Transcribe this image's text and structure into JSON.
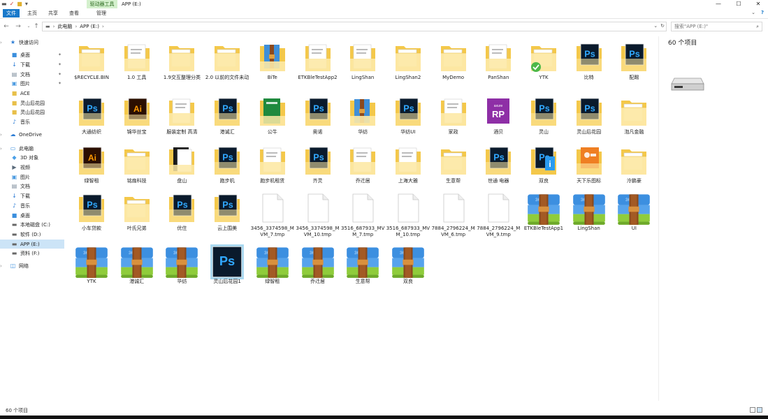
{
  "window": {
    "title": "APP (E:)",
    "context_tab": "驱动器工具",
    "minimize": "—",
    "maximize": "☐",
    "close": "✕"
  },
  "ribbon": {
    "tabs": [
      "文件",
      "主页",
      "共享",
      "查看",
      "管理"
    ],
    "expand": "⌄",
    "help": "?"
  },
  "address": {
    "crumbs": [
      "此电脑",
      "APP (E:)"
    ],
    "search_placeholder": "搜索\"APP (E:)\""
  },
  "nav": [
    {
      "label": "快速访问",
      "icon": "star-icon",
      "sel": false,
      "pin": false
    },
    {
      "label": "桌面",
      "icon": "desktop-icon",
      "sel": false,
      "pin": true
    },
    {
      "label": "下载",
      "icon": "download-icon",
      "sel": false,
      "pin": true
    },
    {
      "label": "文档",
      "icon": "document-icon",
      "sel": false,
      "pin": true
    },
    {
      "label": "图片",
      "icon": "picture-icon",
      "sel": false,
      "pin": true
    },
    {
      "label": "ACE",
      "icon": "folder-icon",
      "sel": false,
      "pin": false
    },
    {
      "label": "灵山后花园",
      "icon": "folder-icon",
      "sel": false,
      "pin": false
    },
    {
      "label": "灵山后花园",
      "icon": "folder-icon",
      "sel": false,
      "pin": false
    },
    {
      "label": "音乐",
      "icon": "music-icon",
      "sel": false,
      "pin": false
    },
    {
      "label": "OneDrive",
      "icon": "cloud-icon",
      "sel": false,
      "pin": false
    },
    {
      "label": "此电脑",
      "icon": "computer-icon",
      "sel": false,
      "pin": false
    },
    {
      "label": "3D 对象",
      "icon": "cube-icon",
      "sel": false,
      "pin": false
    },
    {
      "label": "视频",
      "icon": "video-icon",
      "sel": false,
      "pin": false
    },
    {
      "label": "图片",
      "icon": "picture-icon",
      "sel": false,
      "pin": false
    },
    {
      "label": "文档",
      "icon": "document-icon",
      "sel": false,
      "pin": false
    },
    {
      "label": "下载",
      "icon": "download-icon",
      "sel": false,
      "pin": false
    },
    {
      "label": "音乐",
      "icon": "music-icon",
      "sel": false,
      "pin": false
    },
    {
      "label": "桌面",
      "icon": "desktop-icon",
      "sel": false,
      "pin": false
    },
    {
      "label": "本地磁盘 (C:)",
      "icon": "drive-icon",
      "sel": false,
      "pin": false
    },
    {
      "label": "软件 (D:)",
      "icon": "drive-icon",
      "sel": false,
      "pin": false
    },
    {
      "label": "APP (E:)",
      "icon": "drive-icon",
      "sel": true,
      "pin": false
    },
    {
      "label": "资料 (F:)",
      "icon": "drive-icon",
      "sel": false,
      "pin": false
    },
    {
      "label": "网络",
      "icon": "network-icon",
      "sel": false,
      "pin": false
    }
  ],
  "files": [
    {
      "name": "$RECYCLE.BIN",
      "type": "folder"
    },
    {
      "name": "1.0 工具",
      "type": "folder-doc"
    },
    {
      "name": "1.9交互整理分类",
      "type": "folder"
    },
    {
      "name": "2.0 以前的文件未动",
      "type": "folder"
    },
    {
      "name": "BiTe",
      "type": "folder-zip"
    },
    {
      "name": "ETKBleTestApp2",
      "type": "folder-doc"
    },
    {
      "name": "LingShan",
      "type": "folder-doc"
    },
    {
      "name": "LingShan2",
      "type": "folder"
    },
    {
      "name": "MyDemo",
      "type": "folder"
    },
    {
      "name": "PanShan",
      "type": "folder-doc"
    },
    {
      "name": "YTK",
      "type": "folder-check"
    },
    {
      "name": "比特",
      "type": "folder-ps"
    },
    {
      "name": "配踢",
      "type": "folder-ps"
    },
    {
      "name": "大通纺织",
      "type": "folder-ps"
    },
    {
      "name": "锦华丝宝",
      "type": "folder-ai"
    },
    {
      "name": "服装定制 高清",
      "type": "folder-doc"
    },
    {
      "name": "港诚汇",
      "type": "folder-ps"
    },
    {
      "name": "公牛",
      "type": "folder-green"
    },
    {
      "name": "奥诺",
      "type": "folder-ps"
    },
    {
      "name": "华纺",
      "type": "folder-zip"
    },
    {
      "name": "华纺UI",
      "type": "folder-ps"
    },
    {
      "name": "家政",
      "type": "folder-doc"
    },
    {
      "name": "酒贝",
      "type": "folder-rp"
    },
    {
      "name": "灵山",
      "type": "folder-ps"
    },
    {
      "name": "灵山后花园",
      "type": "folder-ps"
    },
    {
      "name": "泡凡金融",
      "type": "folder"
    },
    {
      "name": "绿智租",
      "type": "folder-ai"
    },
    {
      "name": "铭扇科技",
      "type": "folder"
    },
    {
      "name": "盘山",
      "type": "folder-dark"
    },
    {
      "name": "跑步机",
      "type": "folder-ps"
    },
    {
      "name": "跑步机租赁",
      "type": "folder-doc"
    },
    {
      "name": "齐灵",
      "type": "folder-ps"
    },
    {
      "name": "乔迁居",
      "type": "folder-doc"
    },
    {
      "name": "上海大雅",
      "type": "folder-doc"
    },
    {
      "name": "生意帮",
      "type": "folder"
    },
    {
      "name": "世通 电器",
      "type": "folder-ps"
    },
    {
      "name": "双良",
      "type": "folder-blue"
    },
    {
      "name": "天下乐图标",
      "type": "folder-orange"
    },
    {
      "name": "泠鹏豪",
      "type": "folder"
    },
    {
      "name": "小车贷款",
      "type": "folder-ps"
    },
    {
      "name": "叶氏兄弟",
      "type": "folder"
    },
    {
      "name": "优住",
      "type": "folder-ps"
    },
    {
      "name": "云上围美",
      "type": "folder-ps"
    },
    {
      "name": "3456_3374598_MVM_7.tmp",
      "type": "file"
    },
    {
      "name": "3456_3374598_MVM_10.tmp",
      "type": "file"
    },
    {
      "name": "3516_687933_MVM_7.tmp",
      "type": "file"
    },
    {
      "name": "3516_687933_MVM_10.tmp",
      "type": "file"
    },
    {
      "name": "7884_2796224_MVM_6.tmp",
      "type": "file"
    },
    {
      "name": "7884_2796224_MVM_9.tmp",
      "type": "file"
    },
    {
      "name": "ETKBleTestApp1",
      "type": "archive"
    },
    {
      "name": "LingShan",
      "type": "archive"
    },
    {
      "name": "UI",
      "type": "archive"
    },
    {
      "name": "YTK",
      "type": "archive"
    },
    {
      "name": "港诚汇",
      "type": "archive"
    },
    {
      "name": "华纺",
      "type": "archive"
    },
    {
      "name": "灵山后花园1",
      "type": "psd"
    },
    {
      "name": "绿智租",
      "type": "archive"
    },
    {
      "name": "乔迁居",
      "type": "archive"
    },
    {
      "name": "生意帮",
      "type": "archive"
    },
    {
      "name": "双良",
      "type": "archive"
    }
  ],
  "details": {
    "count": "60 个项目"
  },
  "status": {
    "count": "60 个项目"
  },
  "colors": {
    "folder": "#f4c84a",
    "folder_light": "#fde9a6",
    "ps": "#0a1a2c",
    "ps_text": "#31a8ff",
    "ai": "#2b0f00",
    "ai_text": "#ff9a00",
    "selection": "#cce4f7",
    "accent": "#1979ca"
  }
}
